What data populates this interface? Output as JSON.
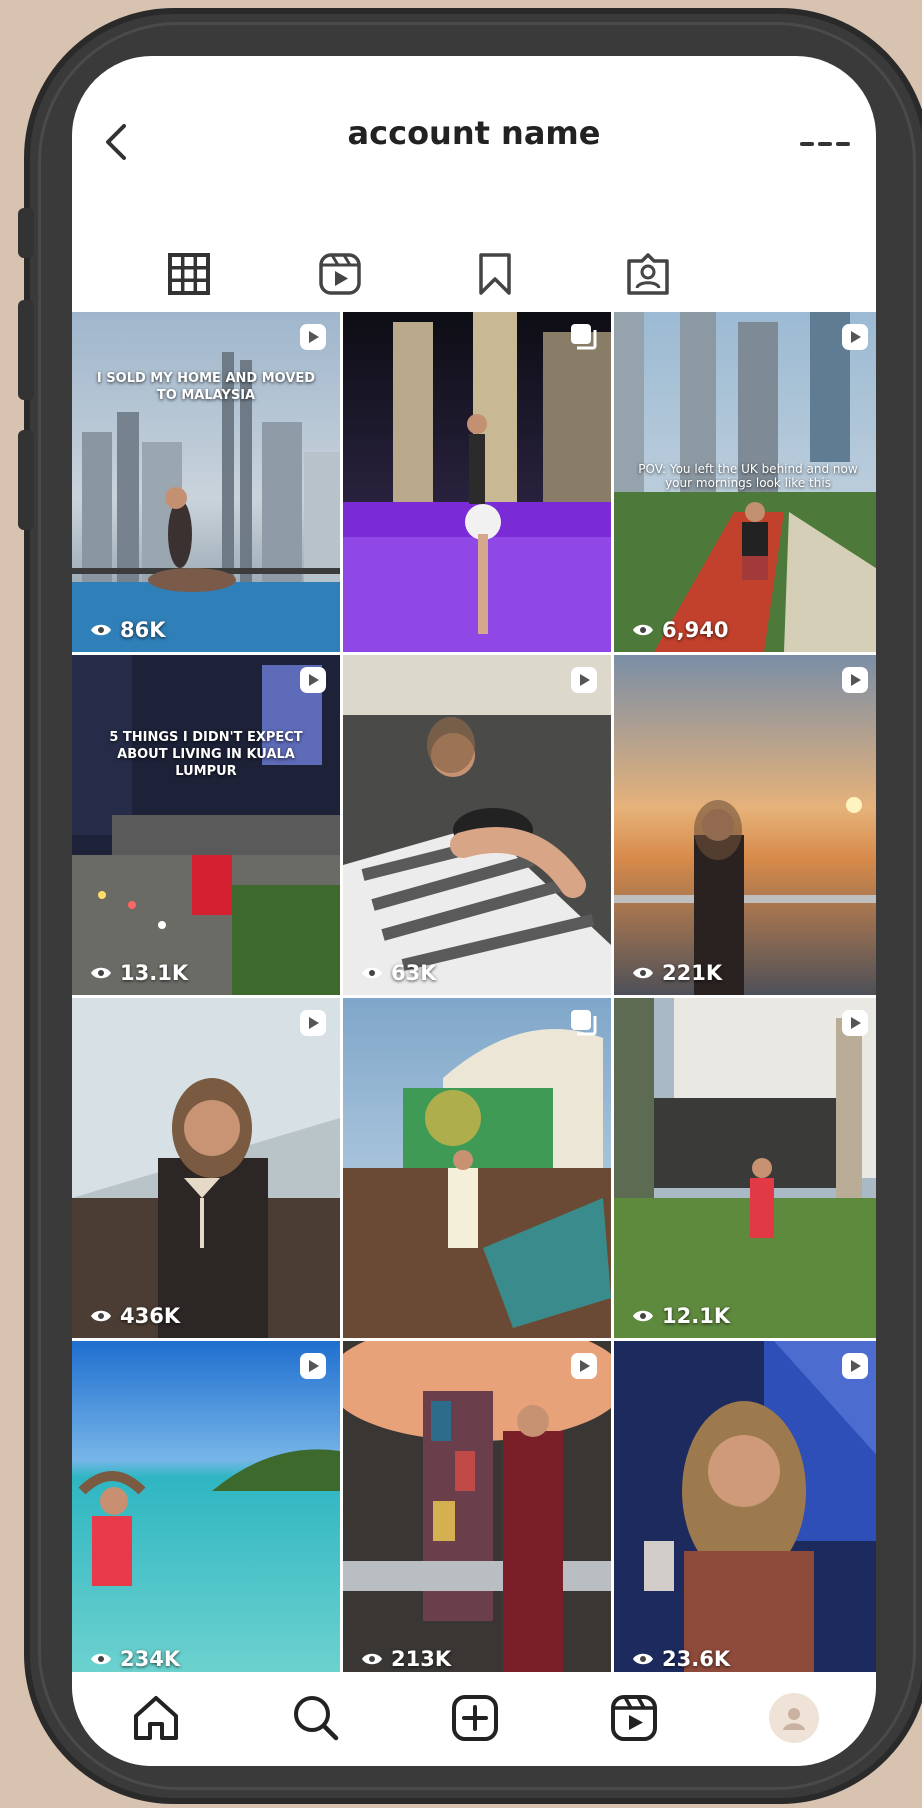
{
  "header": {
    "title": "account name",
    "back_icon": "chevron-left-icon",
    "more_icon": "more-icon"
  },
  "tabs": [
    {
      "id": "grid",
      "icon": "grid-icon",
      "active": true
    },
    {
      "id": "reels",
      "icon": "reels-icon",
      "active": false
    },
    {
      "id": "saved",
      "icon": "bookmark-icon",
      "active": false
    },
    {
      "id": "tagged",
      "icon": "tagged-icon",
      "active": false
    }
  ],
  "posts": [
    {
      "views": "86K",
      "caption": "I SOLD MY HOME AND MOVED TO MALAYSIA",
      "badge": "reel-icon"
    },
    {
      "views": "",
      "caption": "",
      "badge": "carousel-icon"
    },
    {
      "views": "6,940",
      "caption": "POV: You left the UK behind and now your mornings look like this",
      "badge": "reel-icon"
    },
    {
      "views": "13.1K",
      "caption": "5 THINGS I DIDN'T EXPECT ABOUT LIVING IN KUALA LUMPUR",
      "badge": "reel-icon"
    },
    {
      "views": "63K",
      "caption": "",
      "badge": "reel-icon"
    },
    {
      "views": "221K",
      "caption": "",
      "badge": "reel-icon"
    },
    {
      "views": "436K",
      "caption": "",
      "badge": "reel-icon"
    },
    {
      "views": "",
      "caption": "",
      "badge": "carousel-icon"
    },
    {
      "views": "12.1K",
      "caption": "",
      "badge": "reel-icon"
    },
    {
      "views": "234K",
      "caption": "",
      "badge": "reel-icon"
    },
    {
      "views": "213K",
      "caption": "",
      "badge": "reel-icon"
    },
    {
      "views": "23.6K",
      "caption": "",
      "badge": "reel-icon"
    }
  ],
  "nav": [
    {
      "id": "home",
      "icon": "home-icon"
    },
    {
      "id": "search",
      "icon": "search-icon"
    },
    {
      "id": "create",
      "icon": "add-post-icon"
    },
    {
      "id": "reels",
      "icon": "reels-icon"
    },
    {
      "id": "profile",
      "icon": "avatar-icon"
    }
  ],
  "colors": {
    "background": "#d8c3b1",
    "phone_frame": "#3a3a3a",
    "icon": "#333333"
  }
}
